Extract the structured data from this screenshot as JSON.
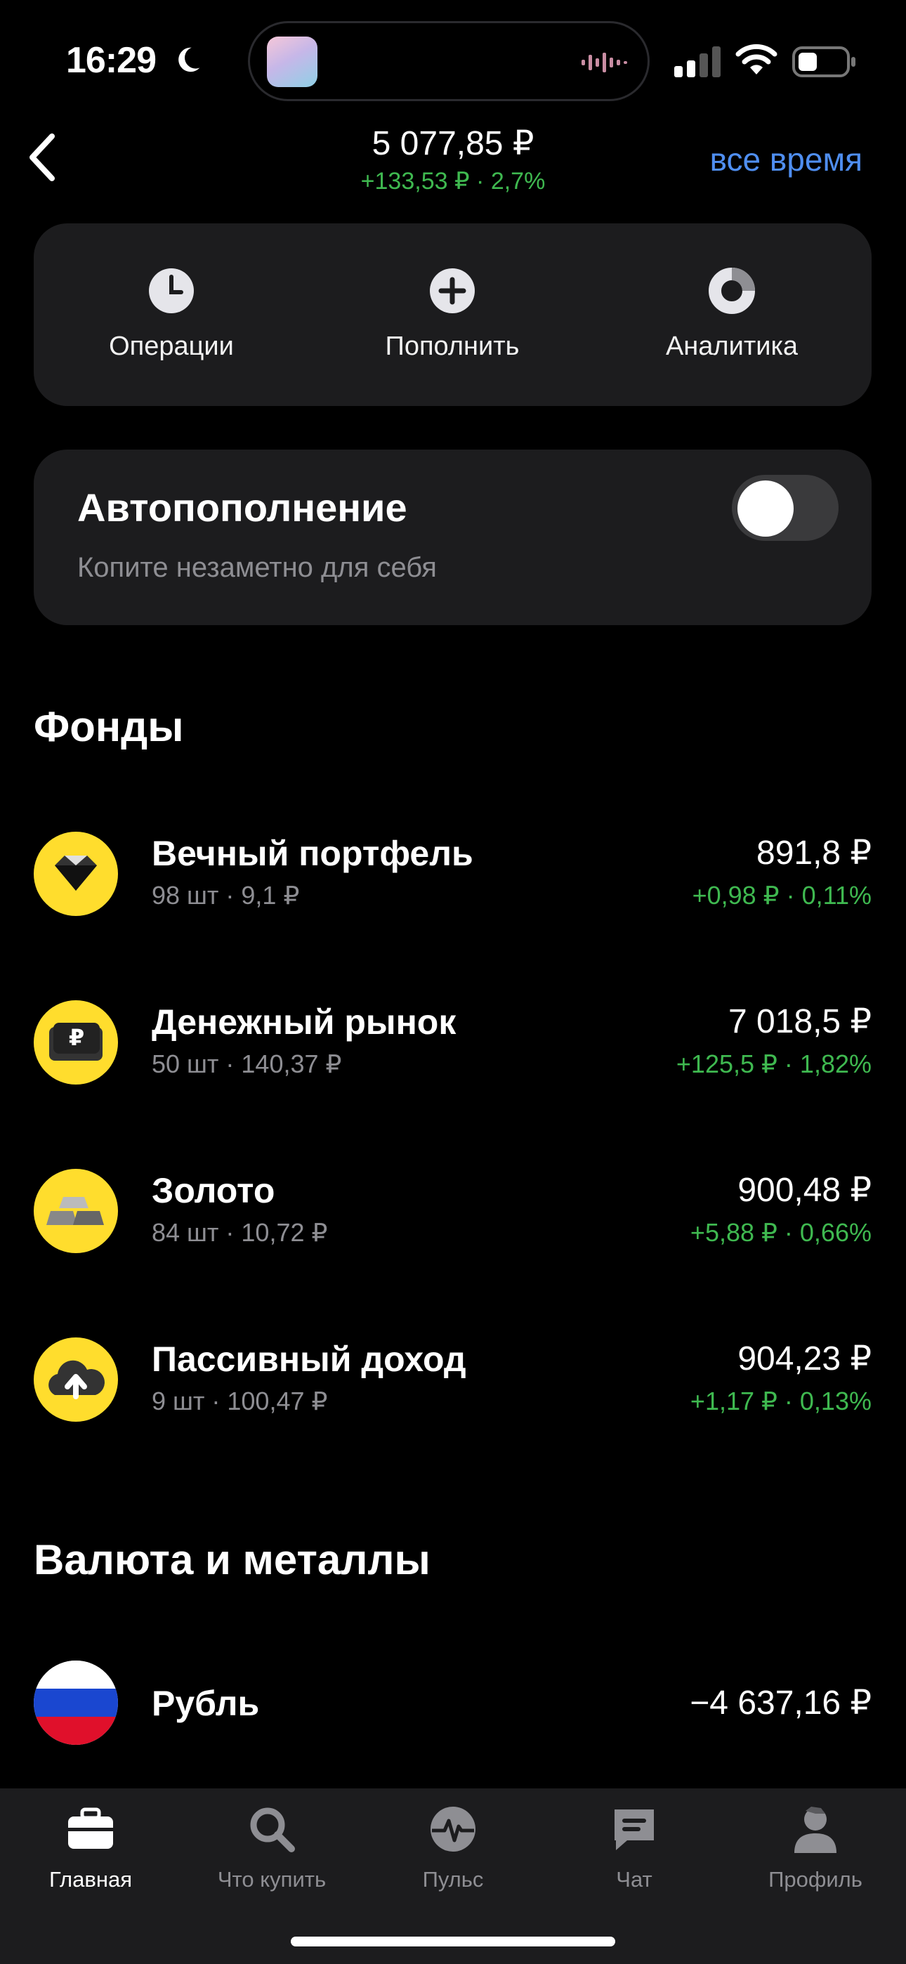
{
  "status_bar": {
    "time": "16:29"
  },
  "header": {
    "balance": "5 077,85 ₽",
    "change": "+133,53 ₽ · 2,7%",
    "period": "все время"
  },
  "actions": [
    {
      "label": "Операции",
      "icon": "clock-icon"
    },
    {
      "label": "Пополнить",
      "icon": "plus-circle-icon"
    },
    {
      "label": "Аналитика",
      "icon": "pie-chart-icon"
    }
  ],
  "autopay": {
    "title": "Автопополнение",
    "subtitle": "Копите незаметно для себя",
    "enabled": false
  },
  "funds": {
    "title": "Фонды",
    "items": [
      {
        "name": "Вечный портфель",
        "meta": "98 шт · 9,1 ₽",
        "value": "891,8 ₽",
        "change": "+0,98 ₽ · 0,11%",
        "icon": "diamond-icon"
      },
      {
        "name": "Денежный рынок",
        "meta": "50 шт · 140,37 ₽",
        "value": "7 018,5 ₽",
        "change": "+125,5 ₽ · 1,82%",
        "icon": "ruble-wallet-icon"
      },
      {
        "name": "Золото",
        "meta": "84 шт · 10,72 ₽",
        "value": "900,48 ₽",
        "change": "+5,88 ₽ · 0,66%",
        "icon": "gold-bars-icon"
      },
      {
        "name": "Пассивный доход",
        "meta": "9 шт · 100,47 ₽",
        "value": "904,23 ₽",
        "change": "+1,17 ₽ · 0,13%",
        "icon": "cloud-arrow-icon"
      }
    ]
  },
  "currency": {
    "title": "Валюта и металлы",
    "items": [
      {
        "name": "Рубль",
        "value": "−4 637,16 ₽",
        "icon": "russia-flag-icon"
      }
    ]
  },
  "tabbar": {
    "items": [
      {
        "label": "Главная",
        "icon": "briefcase-icon",
        "active": true
      },
      {
        "label": "Что купить",
        "icon": "search-icon",
        "active": false
      },
      {
        "label": "Пульс",
        "icon": "pulse-icon",
        "active": false
      },
      {
        "label": "Чат",
        "icon": "chat-icon",
        "active": false
      },
      {
        "label": "Профиль",
        "icon": "profile-icon",
        "active": false
      }
    ]
  },
  "colors": {
    "positive": "#3fb950",
    "accent": "#4f8ef0",
    "brand_yellow": "#ffdd2d",
    "card": "#1c1c1e"
  }
}
